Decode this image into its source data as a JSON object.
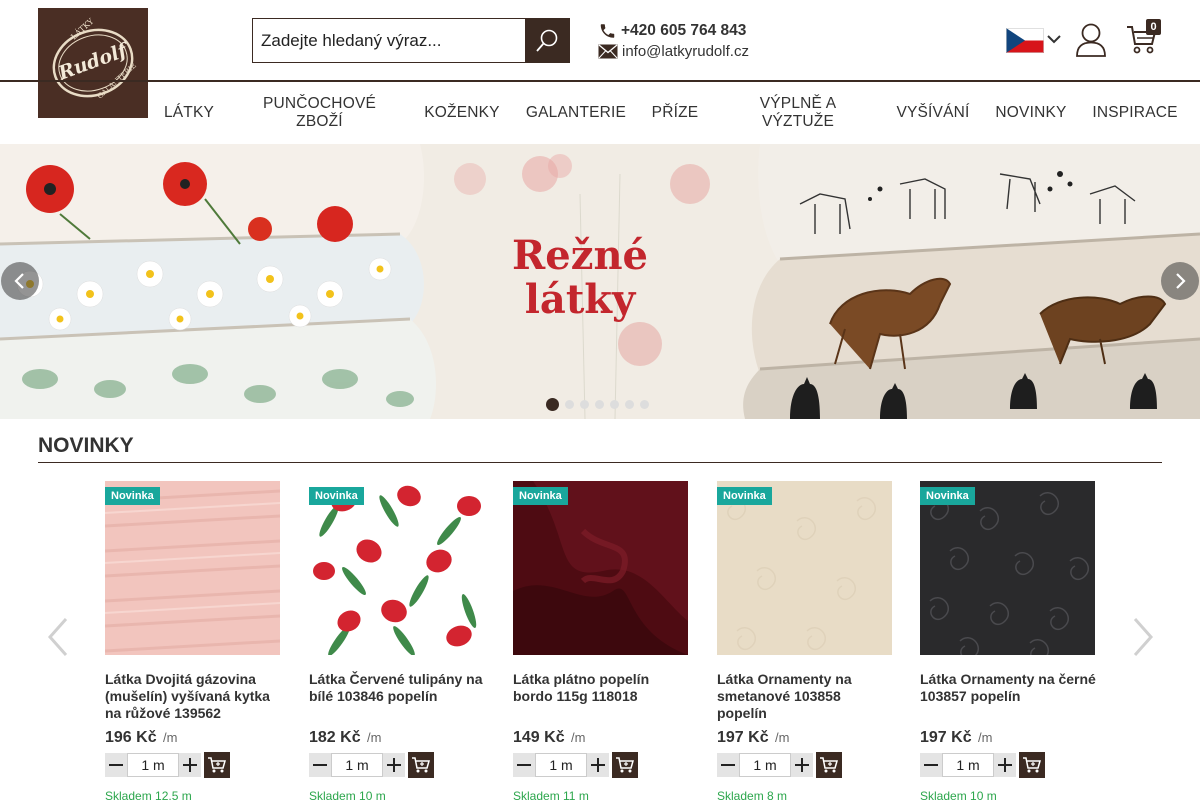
{
  "header": {
    "logo_text": {
      "top": "LÁTKY",
      "name": "Rudolf",
      "bottom": "GALANTERIE",
      "since": "tradice od roku 2005"
    },
    "search": {
      "placeholder": "Zadejte hledaný výraz..."
    },
    "phone": "+420 605 764 843",
    "email": "info@latkyrudolf.cz",
    "cart_count": "0",
    "language": "cs"
  },
  "nav": {
    "items": [
      {
        "label": "LÁTKY"
      },
      {
        "label": "PUNČOCHOVÉ ZBOŽÍ"
      },
      {
        "label": "KOŽENKY"
      },
      {
        "label": "GALANTERIE"
      },
      {
        "label": "PŘÍZE"
      },
      {
        "label": "VÝPLNĚ A VÝZTUŽE"
      },
      {
        "label": "VYŠÍVÁNÍ"
      },
      {
        "label": "NOVINKY"
      },
      {
        "label": "INSPIRACE"
      }
    ]
  },
  "banner": {
    "title": "Režné látky",
    "slide_count": 7,
    "active_slide": 1
  },
  "novinky": {
    "title": "NOVINKY",
    "products": [
      {
        "badge": "Novinka",
        "name": "Látka Dvojitá gázovina (mušelín) vyšívaná kytka na růžové 139562",
        "price": "196 Kč",
        "unit": "/m",
        "qty": "1 m",
        "stock": "Skladem 12,5 m",
        "color": "#f2c5be"
      },
      {
        "badge": "Novinka",
        "name": "Látka Červené tulipány na bílé 103846 popelín",
        "price": "182 Kč",
        "unit": "/m",
        "qty": "1 m",
        "stock": "Skladem 10 m",
        "color": "#ffffff"
      },
      {
        "badge": "Novinka",
        "name": "Látka plátno popelín bordo 115g 118018",
        "price": "149 Kč",
        "unit": "/m",
        "qty": "1 m",
        "stock": "Skladem 11 m",
        "color": "#5a0d14"
      },
      {
        "badge": "Novinka",
        "name": "Látka Ornamenty na smetanové 103858 popelín",
        "price": "197 Kč",
        "unit": "/m",
        "qty": "1 m",
        "stock": "Skladem 8 m",
        "color": "#e8dcc6"
      },
      {
        "badge": "Novinka",
        "name": "Látka Ornamenty na černé 103857 popelín",
        "price": "197 Kč",
        "unit": "/m",
        "qty": "1 m",
        "stock": "Skladem 10 m",
        "color": "#2a2a2c"
      }
    ]
  },
  "colors": {
    "brand_dark": "#3b2a22",
    "badge": "#19a79c",
    "stock": "#2ca64c",
    "banner_title": "#c3262d"
  }
}
